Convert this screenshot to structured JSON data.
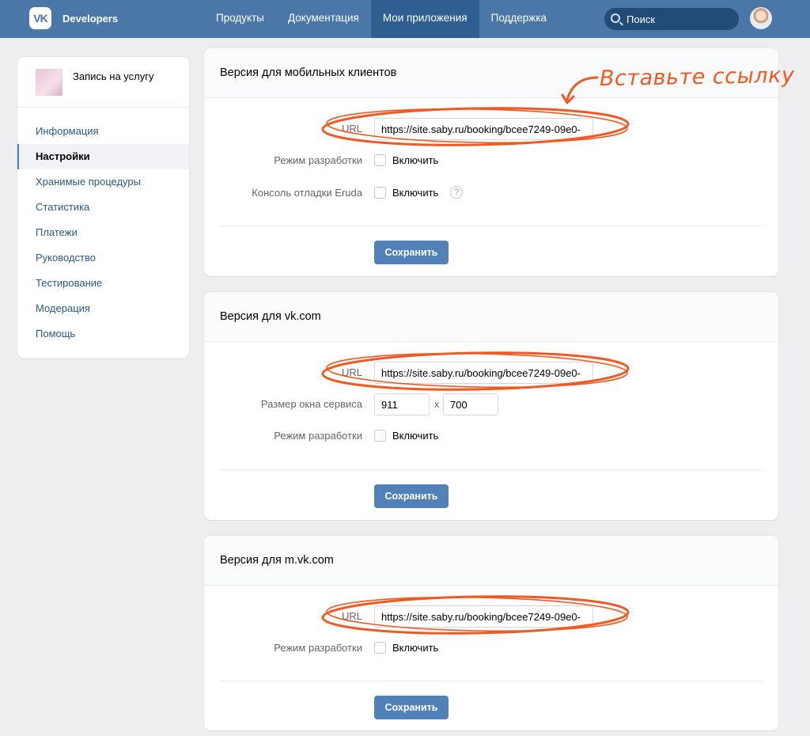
{
  "header": {
    "logo": "VK",
    "brand": "Developers",
    "nav": [
      {
        "label": "Продукты"
      },
      {
        "label": "Документация"
      },
      {
        "label": "Мои приложения"
      },
      {
        "label": "Поддержка"
      }
    ],
    "active_nav": "Мои приложения",
    "search_placeholder": "Поиск"
  },
  "sidebar": {
    "app_name": "Запись на услугу",
    "items": [
      {
        "label": "Информация"
      },
      {
        "label": "Настройки"
      },
      {
        "label": "Хранимые процедуры"
      },
      {
        "label": "Статистика"
      },
      {
        "label": "Платежи"
      },
      {
        "label": "Руководство"
      },
      {
        "label": "Тестирование"
      },
      {
        "label": "Модерация"
      },
      {
        "label": "Помощь"
      }
    ],
    "active_item": "Настройки"
  },
  "annotation": {
    "text": "Вставьте ссылку",
    "color": "#f05a22"
  },
  "panels": {
    "mobile": {
      "title": "Версия для мобильных клиентов",
      "url_label": "URL",
      "url_value": "https://site.saby.ru/booking/bcee7249-09e0-",
      "dev_mode_label": "Режим разработки",
      "dev_mode_check": "Включить",
      "eruda_label": "Консоль отладки Eruda",
      "eruda_check": "Включить",
      "help": "?",
      "save": "Сохранить"
    },
    "vkcom": {
      "title": "Версия для vk.com",
      "url_label": "URL",
      "url_value": "https://site.saby.ru/booking/bcee7249-09e0-",
      "size_label": "Размер окна сервиса",
      "width_value": "911",
      "times": "x",
      "height_value": "700",
      "dev_mode_label": "Режим разработки",
      "dev_mode_check": "Включить",
      "save": "Сохранить"
    },
    "mvkcom": {
      "title": "Версия для m.vk.com",
      "url_label": "URL",
      "url_value": "https://site.saby.ru/booking/bcee7249-09e0-",
      "dev_mode_label": "Режим разработки",
      "dev_mode_check": "Включить",
      "save": "Сохранить"
    }
  },
  "colors": {
    "header_bg": "#4a76a8",
    "active_nav_bg": "#2f5e90",
    "link": "#2a5885",
    "button": "#5181b8",
    "page_bg": "#edeef0"
  }
}
